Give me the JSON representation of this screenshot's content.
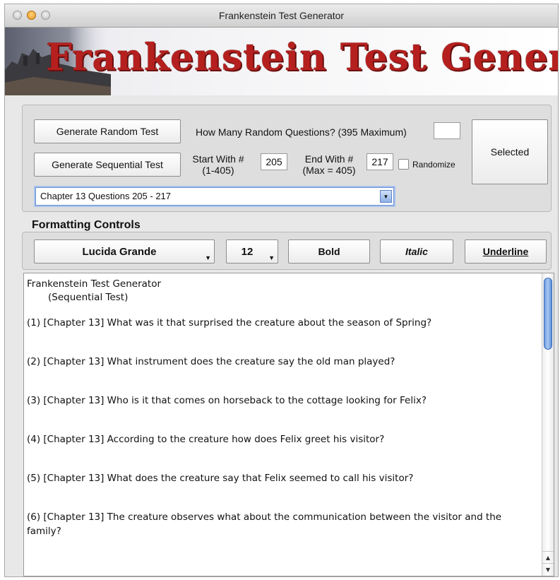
{
  "window": {
    "title": "Frankenstein Test Generator"
  },
  "banner": {
    "text": "Frankenstein Test Generator"
  },
  "controls": {
    "random_button": "Generate Random Test",
    "random_prompt": "How Many Random Questions? (395 Maximum)",
    "random_count": "",
    "selected_button": "Selected",
    "sequential_button": "Generate Sequential Test",
    "start_label_line1": "Start With #",
    "start_label_line2": "(1-405)",
    "start_value": "205",
    "end_label_line1": "End With #",
    "end_label_line2": "(Max = 405)",
    "end_value": "217",
    "randomize_label": "Randomize",
    "randomize_checked": false,
    "chapter_select": "Chapter 13  Questions 205 - 217"
  },
  "formatting": {
    "title": "Formatting Controls",
    "font": "Lucida Grande",
    "size": "12",
    "bold": "Bold",
    "italic": "Italic",
    "underline": "Underline"
  },
  "document": {
    "heading": "Frankenstein Test Generator",
    "subheading": "(Sequential Test)",
    "questions": [
      "(1)  [Chapter 13]  What was it that surprised the creature about the season of Spring?",
      "(2)  [Chapter 13]  What instrument does the creature say the old man played?",
      "(3)  [Chapter 13]  Who is it that comes on horseback to the cottage looking for Felix?",
      "(4)  [Chapter 13]  According to the creature how does Felix greet his visitor?",
      "(5)  [Chapter 13]  What does the creature say that Felix seemed to call his visitor?",
      "(6)  [Chapter 13]  The creature observes what about the communication between the visitor and the family?"
    ]
  }
}
